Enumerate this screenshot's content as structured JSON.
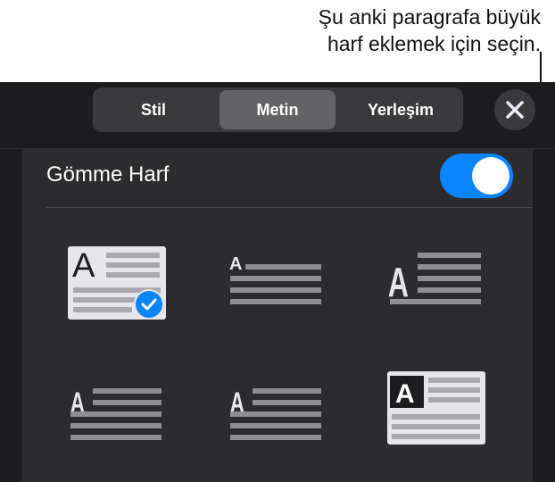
{
  "callout": {
    "line1": "Şu anki paragrafa büyük",
    "line2": "harf eklemek için seçin."
  },
  "tabs": [
    {
      "label": "Stil",
      "active": false
    },
    {
      "label": "Metin",
      "active": true
    },
    {
      "label": "Yerleşim",
      "active": false
    }
  ],
  "drop_cap": {
    "label": "Gömme Harf",
    "enabled": true
  },
  "styles": {
    "letter": "A",
    "selected_index": 0,
    "count": 6
  },
  "colors": {
    "accent": "#0a84ff",
    "panel": "#2c2c2e",
    "background": "#1c1c1e"
  }
}
